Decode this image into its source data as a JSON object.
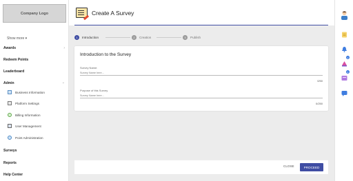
{
  "sidebar": {
    "logo": "Company Logo",
    "show_more": "Show more ▾",
    "items": [
      {
        "label": "Awards"
      },
      {
        "label": "Redeem Points"
      },
      {
        "label": "Leaderboard"
      },
      {
        "label": "Admin"
      }
    ],
    "admin_sub": [
      {
        "label": "Business Information",
        "icon": "building-icon"
      },
      {
        "label": "Platform Settings",
        "icon": "settings-icon"
      },
      {
        "label": "Billing Information",
        "icon": "billing-icon"
      },
      {
        "label": "User Management",
        "icon": "users-icon"
      },
      {
        "label": "Point Administration",
        "icon": "points-icon"
      }
    ],
    "bottom_items": [
      {
        "label": "Surveys"
      },
      {
        "label": "Reports"
      },
      {
        "label": "Help Center"
      }
    ]
  },
  "header": {
    "title": "Create A Survey"
  },
  "stepper": {
    "steps": [
      {
        "num": "1",
        "label": "Introduction",
        "active": true
      },
      {
        "num": "2",
        "label": "Creation",
        "active": false
      },
      {
        "num": "3",
        "label": "Publish",
        "active": false
      }
    ]
  },
  "card": {
    "title": "Introduction to the Survey",
    "fields": [
      {
        "label": "Survey Name:",
        "placeholder": "Survey Name here...",
        "counter": "0/50"
      },
      {
        "label": "Purpose of this Survey",
        "placeholder": "Survey Name here...",
        "counter": "0/250"
      }
    ]
  },
  "footer": {
    "close": "CLOSE",
    "proceed": "PROCEED"
  },
  "rail": {
    "icons": [
      "avatar",
      "document-icon",
      "bell-icon",
      "trophy-icon",
      "notification-icon",
      "chat-icon"
    ],
    "badges": [
      "2",
      "6"
    ]
  },
  "colors": {
    "accent": "#3f4da3",
    "sidebar_bg": "#ffffff",
    "page_bg": "#ececec"
  }
}
